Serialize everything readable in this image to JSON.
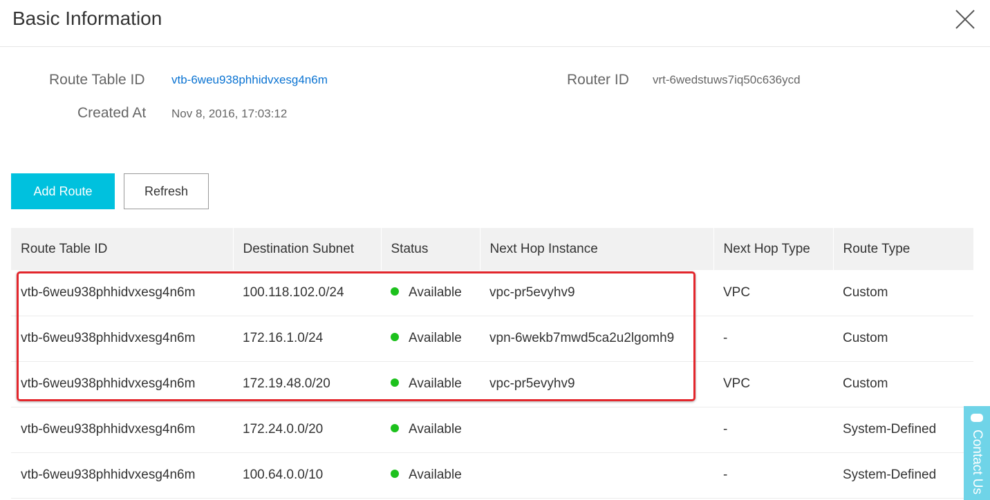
{
  "header": {
    "title": "Basic Information"
  },
  "info": {
    "route_table_id_label": "Route Table ID",
    "route_table_id_value": "vtb-6weu938phhidvxesg4n6m",
    "router_id_label": "Router ID",
    "router_id_value": "vrt-6wedstuws7iq50c636ycd",
    "created_at_label": "Created At",
    "created_at_value": "Nov 8, 2016, 17:03:12"
  },
  "toolbar": {
    "add_route_label": "Add Route",
    "refresh_label": "Refresh"
  },
  "table": {
    "columns": [
      "Route Table ID",
      "Destination Subnet",
      "Status",
      "Next Hop Instance",
      "Next Hop Type",
      "Route Type"
    ],
    "rows": [
      [
        "vtb-6weu938phhidvxesg4n6m",
        "100.118.102.0/24",
        "Available",
        "vpc-pr5evyhv9",
        "VPC",
        "Custom"
      ],
      [
        "vtb-6weu938phhidvxesg4n6m",
        "172.16.1.0/24",
        "Available",
        "vpn-6wekb7mwd5ca2u2lgomh9",
        "-",
        "Custom"
      ],
      [
        "vtb-6weu938phhidvxesg4n6m",
        "172.19.48.0/20",
        "Available",
        "vpc-pr5evyhv9",
        "VPC",
        "Custom"
      ],
      [
        "vtb-6weu938phhidvxesg4n6m",
        "172.24.0.0/20",
        "Available",
        "",
        "-",
        "System-Defined"
      ],
      [
        "vtb-6weu938phhidvxesg4n6m",
        "100.64.0.0/10",
        "Available",
        "",
        "-",
        "System-Defined"
      ]
    ]
  },
  "contact": {
    "label": "Contact Us"
  },
  "colors": {
    "accent": "#00c1de",
    "link": "#0a73d2",
    "status_available": "#1dc11d",
    "highlight": "#e3262c",
    "contact_bg": "#6fd4e8"
  },
  "icons": {
    "close": "close-icon",
    "status": "status-dot-icon",
    "contact": "chat-icon"
  }
}
